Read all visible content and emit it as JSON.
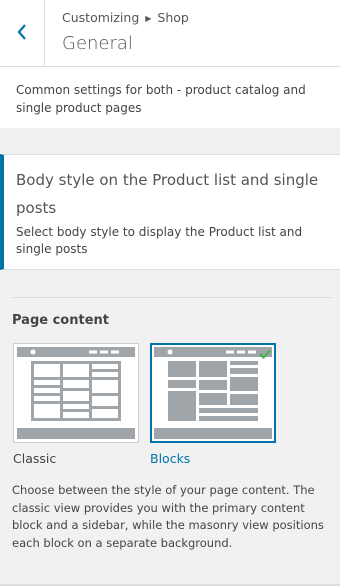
{
  "header": {
    "breadcrumb_parent": "Customizing",
    "breadcrumb_current": "Shop",
    "title": "General",
    "back_icon": "chevron-left-icon"
  },
  "description": "Common settings for both - product catalog and single product pages",
  "section": {
    "title": "Body style on the Product list and single posts",
    "subtitle": "Select body style to display the Product list and single posts"
  },
  "page_content": {
    "label": "Page content",
    "options": [
      {
        "label": "Classic",
        "selected": false
      },
      {
        "label": "Blocks",
        "selected": true
      }
    ],
    "help": "Choose between the style of your page content. The classic view provides you with the primary content block and a sidebar, while the masonry view positions each block on a separate background."
  },
  "colors": {
    "accent": "#0073aa",
    "check": "#46b450",
    "thumb_gray": "#a0a5aa"
  }
}
